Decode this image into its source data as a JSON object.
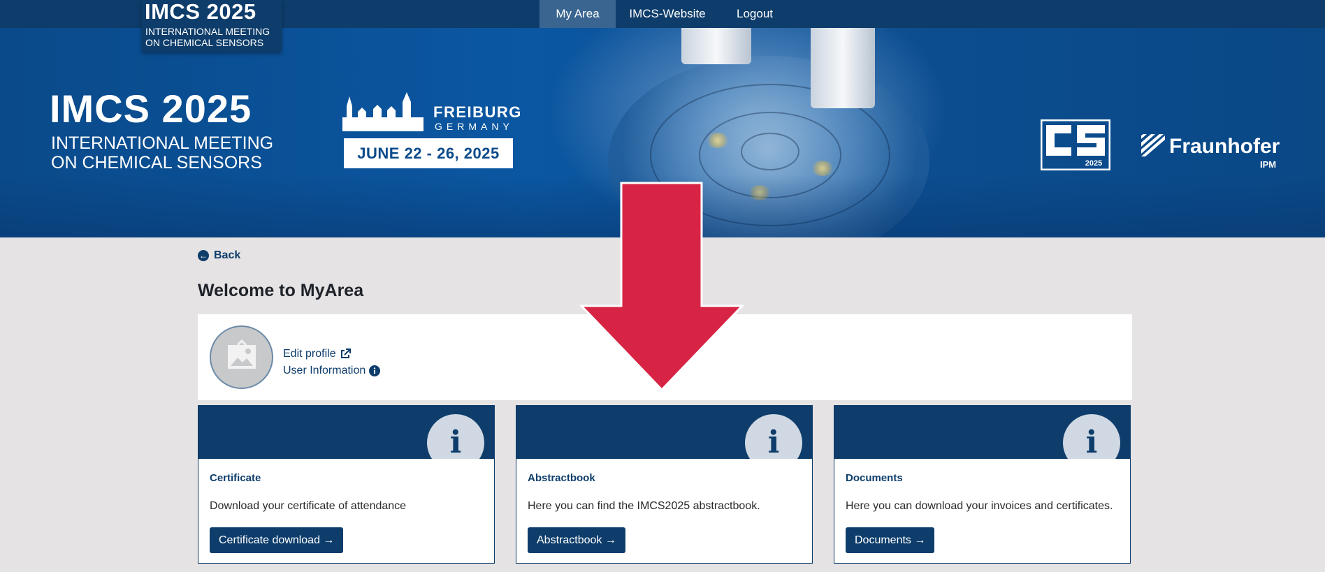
{
  "nav": {
    "logo_title": "IMCS 2025",
    "logo_subtitle_1": "INTERNATIONAL MEETING",
    "logo_subtitle_2": "ON CHEMICAL SENSORS",
    "items": [
      {
        "label": "My Area",
        "active": true
      },
      {
        "label": "IMCS-Website",
        "active": false
      },
      {
        "label": "Logout",
        "active": false
      }
    ]
  },
  "banner": {
    "title": "IMCS 2025",
    "subtitle_1": "INTERNATIONAL MEETING",
    "subtitle_2": "ON CHEMICAL SENSORS",
    "city": "FREIBURG",
    "country": "GERMANY",
    "dates": "JUNE 22 - 26, 2025",
    "cs_logo_year": "2025",
    "partner": "Fraunhofer",
    "partner_sub": "IPM"
  },
  "back_label": "Back",
  "page_title": "Welcome to MyArea",
  "profile": {
    "edit_label": "Edit profile",
    "info_label": "User Information"
  },
  "cards": [
    {
      "title": "Certificate",
      "description": "Download your certificate of attendance",
      "button": "Certificate download →"
    },
    {
      "title": "Abstractbook",
      "description": "Here you can find the IMCS2025 abstractbook.",
      "button": "Abstractbook →"
    },
    {
      "title": "Documents",
      "description": "Here you can download your invoices and certificates.",
      "button": "Documents →"
    }
  ],
  "colors": {
    "navy": "#0e3d6b",
    "banner_blue": "#0b57a2",
    "arrow_red": "#d72445",
    "page_bg": "#e5e3e4"
  },
  "icons": {
    "back": "arrow-circle-left-icon",
    "edit": "external-link-icon",
    "user_info": "info-circle-icon",
    "card": "info-icon",
    "avatar": "image-placeholder-icon"
  }
}
